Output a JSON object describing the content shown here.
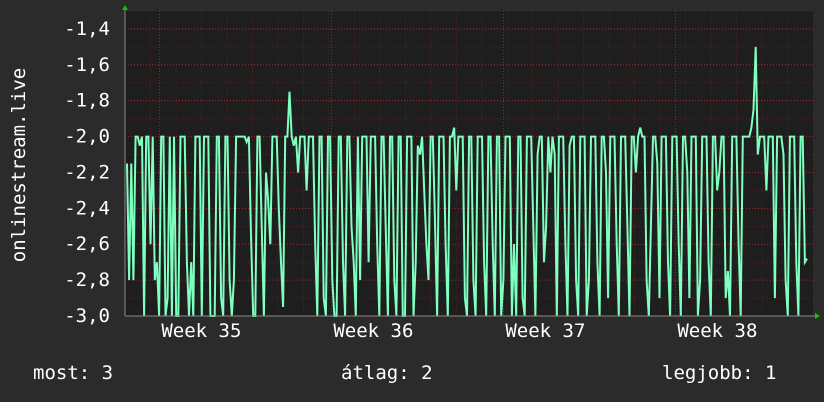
{
  "chart_data": {
    "type": "line",
    "ylabel": "onlinestream.live",
    "ylim": [
      -3.0,
      -1.3
    ],
    "yticks": [
      "-1,4",
      "-1,6",
      "-1,8",
      "-2,0",
      "-2,2",
      "-2,4",
      "-2,6",
      "-2,8",
      "-3,0"
    ],
    "ytick_values": [
      -1.4,
      -1.6,
      -1.8,
      -2.0,
      -2.2,
      -2.4,
      -2.6,
      -2.8,
      -3.0
    ],
    "xticks": [
      "Week 35",
      "Week 36",
      "Week 37",
      "Week 38"
    ],
    "xtick_positions": [
      0.175,
      0.425,
      0.675,
      0.925
    ],
    "grid": true,
    "series_color": "#7fffc0",
    "series": [
      {
        "values": [
          -2.15,
          -2.8,
          -2.15,
          -2.8,
          -2.0,
          -2.0,
          -2.05,
          -2.0,
          -3.0,
          -2.0,
          -2.0,
          -2.6,
          -2.0,
          -2.8,
          -2.7,
          -3.0,
          -2.0,
          -2.0,
          -3.0,
          -2.9,
          -2.0,
          -3.0,
          -2.0,
          -3.0,
          -3.0,
          -2.0,
          -2.0,
          -2.0,
          -2.7,
          -3.0,
          -2.7,
          -3.0,
          -2.0,
          -2.0,
          -2.0,
          -3.0,
          -2.0,
          -2.0,
          -2.0,
          -3.0,
          -3.0,
          -3.0,
          -2.0,
          -2.0,
          -2.9,
          -3.0,
          -2.0,
          -2.0,
          -2.8,
          -3.0,
          -2.8,
          -2.0,
          -2.0,
          -2.0,
          -2.0,
          -2.0,
          -2.03,
          -2.0,
          -2.55,
          -3.0,
          -3.0,
          -2.0,
          -2.0,
          -2.5,
          -3.0,
          -2.2,
          -2.35,
          -2.6,
          -2.0,
          -2.0,
          -2.0,
          -2.4,
          -2.7,
          -2.95,
          -2.0,
          -2.0,
          -1.75,
          -2.0,
          -2.05,
          -2.0,
          -2.2,
          -2.0,
          -2.0,
          -2.0,
          -2.3,
          -2.0,
          -2.0,
          -2.0,
          -2.6,
          -3.0,
          -2.0,
          -2.0,
          -2.9,
          -3.0,
          -2.0,
          -2.0,
          -2.8,
          -3.0,
          -3.0,
          -2.0,
          -2.0,
          -2.7,
          -3.0,
          -2.0,
          -2.0,
          -2.5,
          -2.7,
          -3.0,
          -2.0,
          -2.8,
          -2.0,
          -2.0,
          -2.0,
          -2.7,
          -2.0,
          -2.0,
          -2.0,
          -2.6,
          -3.0,
          -2.0,
          -2.0,
          -2.5,
          -3.0,
          -2.0,
          -2.0,
          -2.8,
          -3.0,
          -2.0,
          -2.0,
          -3.0,
          -3.0,
          -2.0,
          -2.0,
          -2.0,
          -3.0,
          -2.7,
          -2.05,
          -2.1,
          -2.0,
          -2.3,
          -2.6,
          -2.8,
          -2.0,
          -2.0,
          -2.45,
          -3.0,
          -2.0,
          -2.0,
          -2.0,
          -2.6,
          -3.0,
          -2.0,
          -2.0,
          -1.95,
          -2.3,
          -2.0,
          -2.0,
          -2.0,
          -2.9,
          -3.0,
          -2.0,
          -2.0,
          -2.8,
          -3.0,
          -2.0,
          -2.0,
          -2.0,
          -2.7,
          -3.0,
          -2.0,
          -2.0,
          -2.6,
          -3.0,
          -2.0,
          -2.0,
          -3.0,
          -2.8,
          -2.0,
          -2.0,
          -2.0,
          -3.0,
          -2.6,
          -3.0,
          -2.0,
          -2.0,
          -2.9,
          -3.0,
          -2.0,
          -2.0,
          -2.0,
          -2.5,
          -3.0,
          -2.1,
          -2.0,
          -2.0,
          -2.7,
          -2.5,
          -2.0,
          -2.2,
          -2.0,
          -2.1,
          -3.0,
          -2.0,
          -2.0,
          -2.0,
          -2.6,
          -3.0,
          -2.05,
          -2.0,
          -2.0,
          -2.8,
          -3.0,
          -2.0,
          -2.0,
          -2.0,
          -3.0,
          -2.8,
          -2.0,
          -2.0,
          -2.0,
          -2.7,
          -3.0,
          -2.0,
          -2.0,
          -2.2,
          -2.9,
          -2.0,
          -2.0,
          -2.0,
          -2.6,
          -3.0,
          -2.0,
          -2.0,
          -2.0,
          -2.5,
          -3.0,
          -2.0,
          -2.0,
          -2.2,
          -2.0,
          -1.95,
          -2.0,
          -2.0,
          -2.8,
          -3.0,
          -2.5,
          -2.0,
          -2.0,
          -2.15,
          -2.9,
          -2.0,
          -2.0,
          -2.0,
          -2.7,
          -3.0,
          -2.0,
          -2.0,
          -2.0,
          -2.6,
          -3.0,
          -2.0,
          -2.0,
          -2.2,
          -2.9,
          -2.0,
          -2.0,
          -2.0,
          -3.0,
          -2.8,
          -2.0,
          -2.0,
          -2.0,
          -2.7,
          -3.0,
          -2.0,
          -2.0,
          -2.3,
          -2.2,
          -2.0,
          -2.0,
          -2.9,
          -2.75,
          -3.0,
          -2.0,
          -2.0,
          -2.0,
          -2.6,
          -3.0,
          -2.0,
          -2.0,
          -2.0,
          -2.0,
          -1.95,
          -1.85,
          -1.5,
          -2.1,
          -2.0,
          -2.0,
          -2.0,
          -2.3,
          -2.0,
          -2.0,
          -2.0,
          -2.9,
          -2.0,
          -2.0,
          -2.0,
          -2.1,
          -2.8,
          -3.0,
          -2.0,
          -2.0,
          -2.0,
          -2.7,
          -3.0,
          -2.0,
          -2.0,
          -2.7,
          -2.68
        ],
        "y_start_fraction": 0.0,
        "y_end_fraction": 1.0
      }
    ],
    "arrow_color": "#00cc00",
    "grid_color": "#e03030"
  },
  "footer": {
    "current": "most: 3",
    "average": "átlag: 2",
    "best": "legjobb: 1"
  }
}
